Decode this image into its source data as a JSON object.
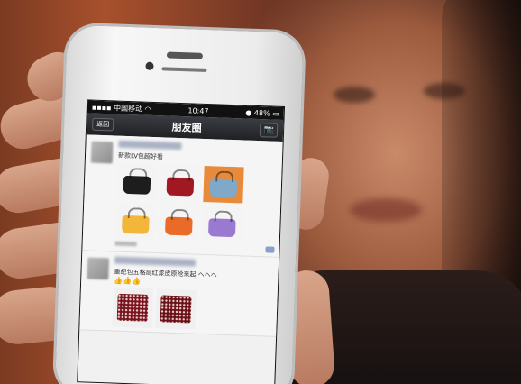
{
  "phone": {
    "status": {
      "carrier": "中国移动",
      "time": "10:47",
      "battery": "48%"
    },
    "nav": {
      "back_label": "返回",
      "title": "朋友圈",
      "camera_icon": "camera-icon"
    },
    "posts": [
      {
        "text": "新款LV包超好看",
        "meta_left": "",
        "thumbs": [
          {
            "bg": "#f4f4f4",
            "bag": "#1d1d1d",
            "icon": "handbag-icon"
          },
          {
            "bg": "#f4f4f4",
            "bag": "#a01822",
            "icon": "handbag-icon"
          },
          {
            "bg": "#e88a3a",
            "bag": "#7fa8c9",
            "icon": "handbag-icon"
          },
          {
            "bg": "#f4f4f4",
            "bag": "#f2b63a",
            "icon": "handbag-icon"
          },
          {
            "bg": "#f4f4f4",
            "bag": "#ea6a28",
            "icon": "handbag-icon"
          },
          {
            "bg": "#f4f4f4",
            "bag": "#9a7ad0",
            "icon": "handbag-icon"
          }
        ]
      },
      {
        "text": "重纪包五格局红漆皮原抢来起 ヘヘヘ",
        "emoji": "👍👍👍",
        "thumbs": [
          {
            "bg": "#f0f0f0",
            "bag": "#7a1220",
            "icon": "handbag-icon"
          },
          {
            "bg": "#f0f0f0",
            "bag": "#6a1018",
            "icon": "handbag-icon"
          }
        ]
      }
    ]
  }
}
